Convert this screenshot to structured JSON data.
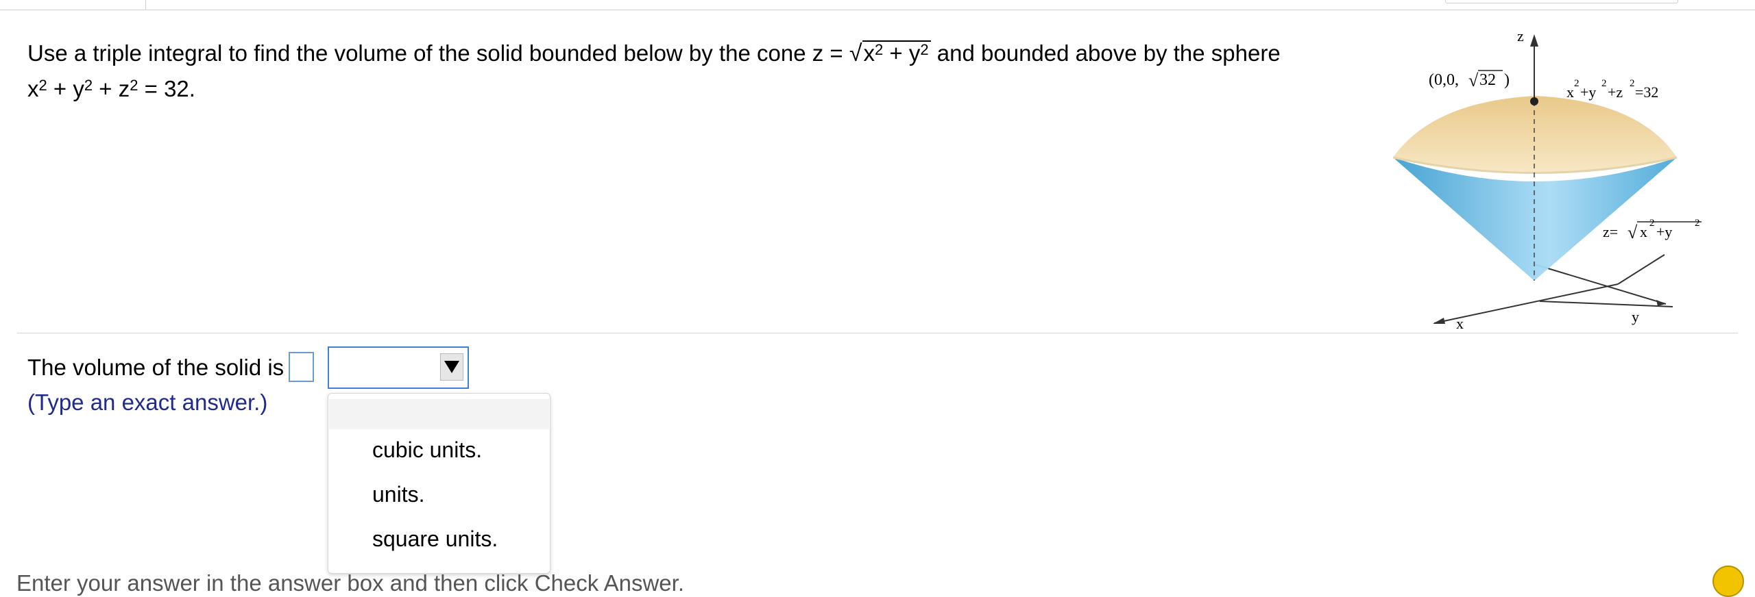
{
  "question": {
    "prefix": "Use a triple integral to find the volume of the solid bounded below by the cone z =",
    "radicand_x": "x",
    "radicand_exp1": "2",
    "radicand_plus": " + y",
    "radicand_exp2": "2",
    "suffix": "and bounded above by the sphere",
    "line2": {
      "x": "x",
      "x_exp": "2",
      "y": " + y",
      "y_exp": "2",
      "z": " + z",
      "z_exp": "2",
      "end": " = 32."
    }
  },
  "figure": {
    "axis_z": "z",
    "axis_x": "x",
    "axis_y": "y",
    "point_prefix": "(0,0,",
    "point_radicand": "32",
    "point_suffix": ")",
    "sphere_x": "x",
    "sphere_x_exp": "2",
    "sphere_y": "+y",
    "sphere_y_exp": "2",
    "sphere_z": "+z",
    "sphere_z_exp": "2",
    "sphere_end": "=32",
    "cone_prefix": "z=",
    "cone_x": "x",
    "cone_x_exp": "2",
    "cone_y": "+y",
    "cone_y_exp": "2",
    "colors": {
      "cap": "#e9c98a",
      "cone": "#5bb3e0"
    }
  },
  "answer": {
    "label": "The volume of the solid is",
    "value": "",
    "selected_unit": "",
    "hint": "(Type an exact answer.)"
  },
  "dropdown": {
    "options": [
      "cubic units.",
      "units.",
      "square units."
    ]
  },
  "footer": {
    "text": "Enter your answer in the answer box and then click Check Answer."
  }
}
